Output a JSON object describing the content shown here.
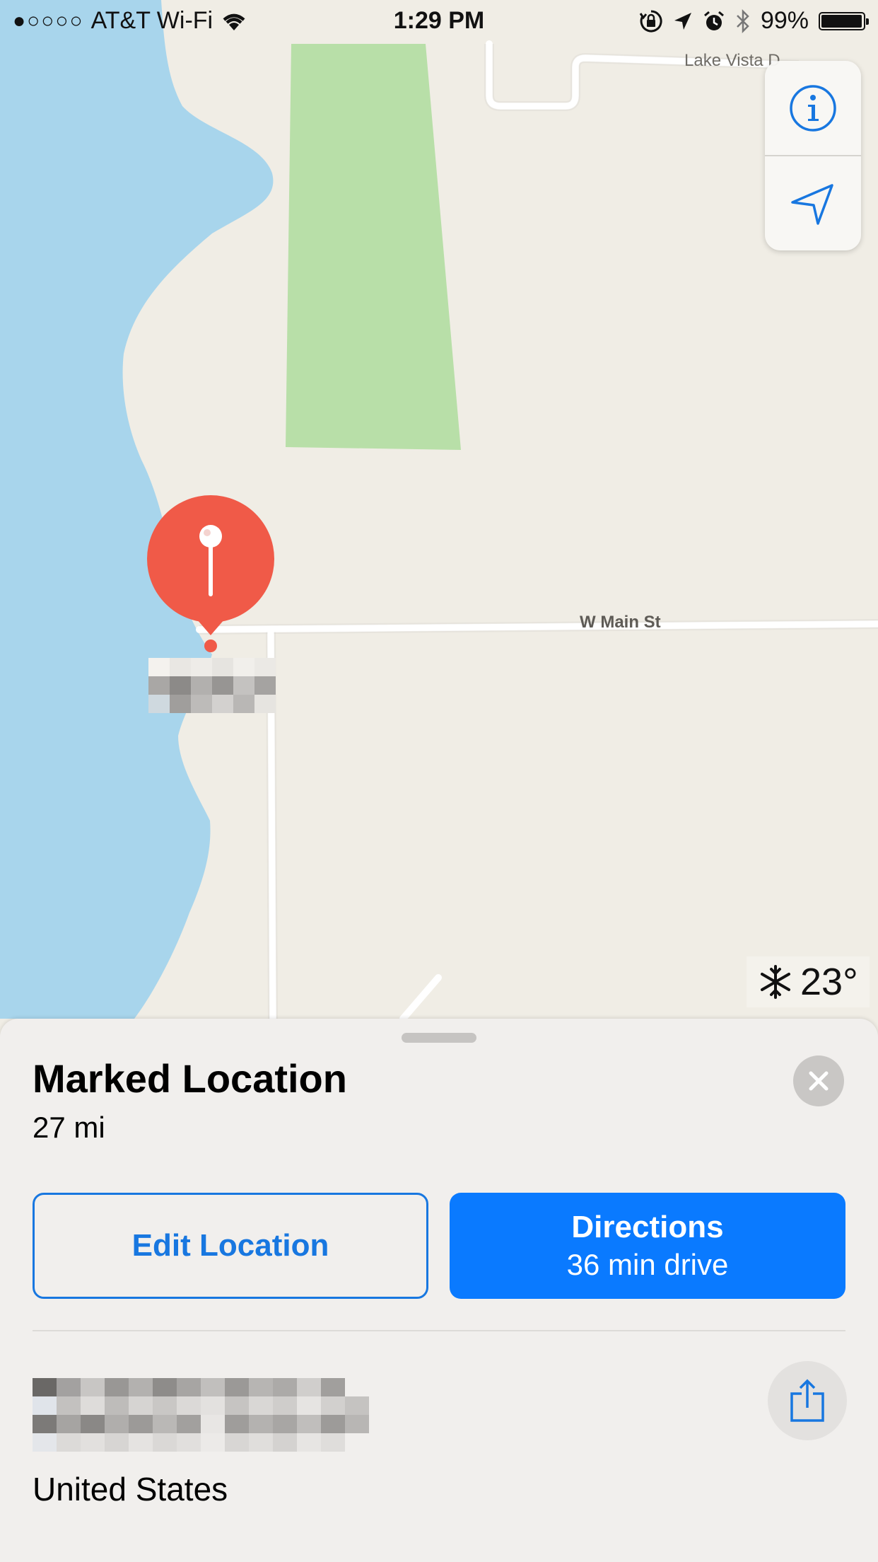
{
  "status_bar": {
    "signal": "●○○○○",
    "carrier": "AT&T Wi-Fi",
    "time": "1:29 PM",
    "battery": "99%"
  },
  "map": {
    "road_labels": {
      "lake_vista": "Lake Vista D",
      "main_street": "W Main St"
    },
    "weather": {
      "icon": "snowflake-icon",
      "temperature": "23°"
    }
  },
  "controls": {
    "info_icon": "info-icon",
    "location_icon": "location-arrow-icon"
  },
  "sheet": {
    "title": "Marked Location",
    "distance": "27 mi",
    "edit_label": "Edit Location",
    "directions_label": "Directions",
    "directions_sub": "36 min drive",
    "address_country": "United States"
  },
  "colors": {
    "accent": "#0a7aff",
    "pin": "#f05a48",
    "water": "#a8d5ec",
    "park": "#b8dfa8",
    "land": "#f0ede5"
  }
}
